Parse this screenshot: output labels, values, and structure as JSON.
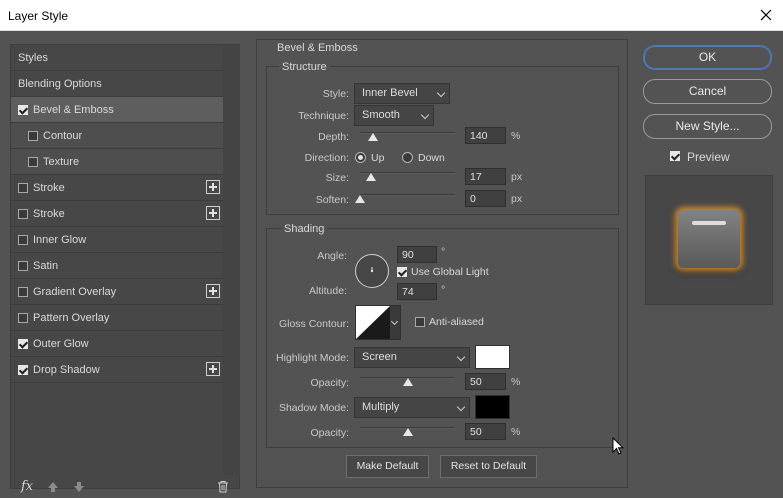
{
  "window": {
    "title": "Layer Style"
  },
  "styles_list": {
    "items": [
      {
        "label": "Styles",
        "type": "header",
        "checked": null,
        "plus": false
      },
      {
        "label": "Blending Options",
        "type": "header",
        "checked": null,
        "plus": false
      },
      {
        "label": "Bevel & Emboss",
        "type": "selected",
        "checked": true,
        "plus": false
      },
      {
        "label": "Contour",
        "type": "sub",
        "checked": false,
        "plus": false
      },
      {
        "label": "Texture",
        "type": "sub",
        "checked": false,
        "plus": false
      },
      {
        "label": "Stroke",
        "type": "item",
        "checked": false,
        "plus": true
      },
      {
        "label": "Stroke",
        "type": "item",
        "checked": false,
        "plus": true
      },
      {
        "label": "Inner Glow",
        "type": "item",
        "checked": false,
        "plus": false
      },
      {
        "label": "Satin",
        "type": "item",
        "checked": false,
        "plus": false
      },
      {
        "label": "Gradient Overlay",
        "type": "item",
        "checked": false,
        "plus": true
      },
      {
        "label": "Pattern Overlay",
        "type": "item",
        "checked": false,
        "plus": false
      },
      {
        "label": "Outer Glow",
        "type": "item",
        "checked": true,
        "plus": false
      },
      {
        "label": "Drop Shadow",
        "type": "item",
        "checked": true,
        "plus": true
      }
    ],
    "fx_label": "fx"
  },
  "bevel": {
    "title": "Bevel & Emboss",
    "structure": {
      "title": "Structure",
      "style_label": "Style:",
      "style_value": "Inner Bevel",
      "technique_label": "Technique:",
      "technique_value": "Smooth",
      "depth_label": "Depth:",
      "depth_value": "140",
      "depth_unit": "%",
      "depth_level": 0.14,
      "direction_label": "Direction:",
      "direction_up": "Up",
      "direction_down": "Down",
      "direction_selected": "Up",
      "size_label": "Size:",
      "size_value": "17",
      "size_unit": "px",
      "size_level": 0.12,
      "soften_label": "Soften:",
      "soften_value": "0",
      "soften_unit": "px",
      "soften_level": 0.0
    },
    "shading": {
      "title": "Shading",
      "angle_label": "Angle:",
      "angle_value": "90",
      "angle_unit": "°",
      "use_global_light": "Use Global Light",
      "use_global_light_checked": true,
      "altitude_label": "Altitude:",
      "altitude_value": "74",
      "altitude_unit": "°",
      "gloss_contour_label": "Gloss Contour:",
      "anti_aliased": "Anti-aliased",
      "anti_aliased_checked": false,
      "highlight_mode_label": "Highlight Mode:",
      "highlight_mode_value": "Screen",
      "highlight_color": "#ffffff",
      "highlight_opacity_label": "Opacity:",
      "highlight_opacity_value": "50",
      "highlight_opacity_unit": "%",
      "highlight_opacity_level": 0.5,
      "shadow_mode_label": "Shadow Mode:",
      "shadow_mode_value": "Multiply",
      "shadow_color": "#000000",
      "shadow_opacity_label": "Opacity:",
      "shadow_opacity_value": "50",
      "shadow_opacity_unit": "%",
      "shadow_opacity_level": 0.5
    },
    "make_default": "Make Default",
    "reset_to_default": "Reset to Default"
  },
  "actions": {
    "ok": "OK",
    "cancel": "Cancel",
    "new_style": "New Style...",
    "preview_label": "Preview",
    "preview_checked": true
  },
  "colors": {
    "accent": "#4d79b5",
    "glow": "#ffa028"
  }
}
